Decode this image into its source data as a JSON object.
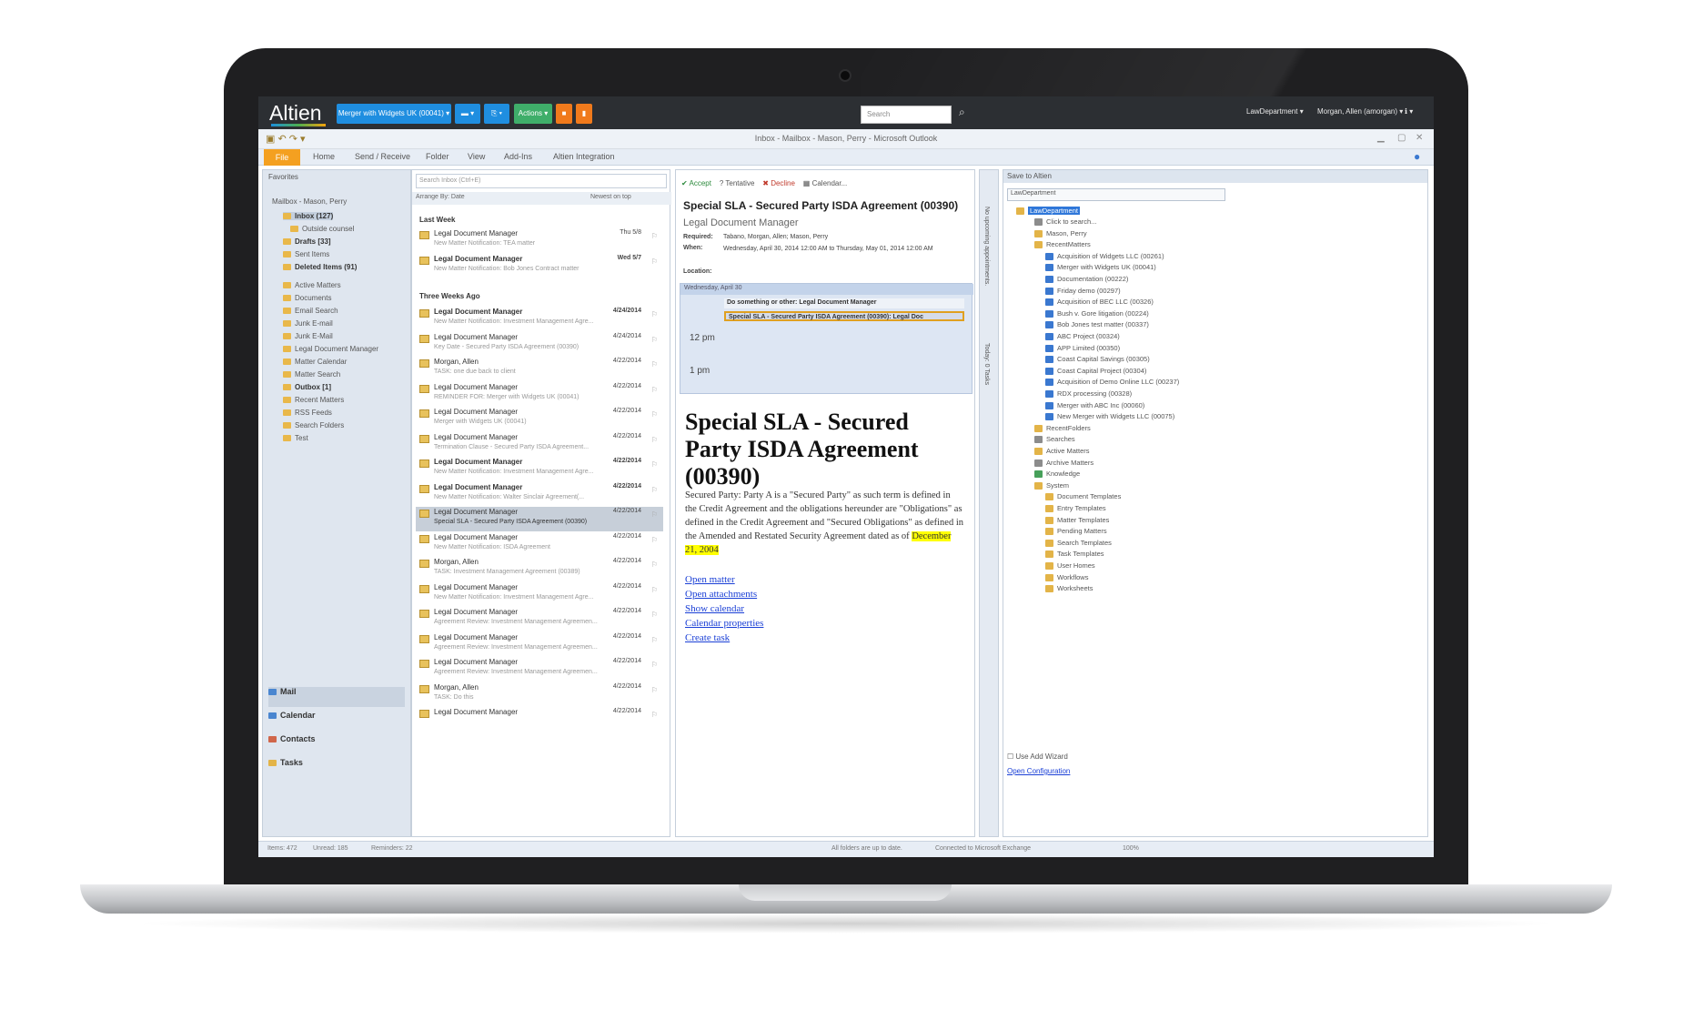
{
  "app": {
    "brand": "Altien",
    "matter_button": "Merger with Widgets UK (00041) ▾",
    "actions_button": "Actions ▾",
    "search_placeholder": "Search",
    "workspace": "LawDepartment ▾",
    "user": "Morgan, Allen (amorgan) ▾",
    "info": "ℹ ▾"
  },
  "outlook": {
    "window_title": "Inbox - Mailbox - Mason, Perry - Microsoft Outlook",
    "tabs": [
      "File",
      "Home",
      "Send / Receive",
      "Folder",
      "View",
      "Add-Ins",
      "Altien Integration"
    ]
  },
  "nav": {
    "favorites": "Favorites",
    "mailbox": "Mailbox - Mason, Perry",
    "folders": [
      {
        "label": "Inbox (127)",
        "bold": true
      },
      {
        "label": "Outside counsel",
        "bold": false
      },
      {
        "label": "Drafts [33]",
        "bold": true
      },
      {
        "label": "Sent Items",
        "bold": false
      },
      {
        "label": "Deleted Items (91)",
        "bold": true
      },
      {
        "label": "Active Matters",
        "bold": false
      },
      {
        "label": "Documents",
        "bold": false
      },
      {
        "label": "Email Search",
        "bold": false
      },
      {
        "label": "Junk E-mail",
        "bold": false
      },
      {
        "label": "Junk E-Mail",
        "bold": false
      },
      {
        "label": "Legal Document Manager",
        "bold": false
      },
      {
        "label": "Matter Calendar",
        "bold": false
      },
      {
        "label": "Matter Search",
        "bold": false
      },
      {
        "label": "Outbox [1]",
        "bold": true
      },
      {
        "label": "Recent Matters",
        "bold": false
      },
      {
        "label": "RSS Feeds",
        "bold": false
      },
      {
        "label": "Search Folders",
        "bold": false
      },
      {
        "label": "Test",
        "bold": false
      }
    ],
    "bottom": [
      "Mail",
      "Calendar",
      "Contacts",
      "Tasks"
    ]
  },
  "list": {
    "search_placeholder": "Search Inbox (Ctrl+E)",
    "arrange": "Arrange By: Date",
    "order": "Newest on top",
    "group_last_week": "Last Week",
    "group_three_weeks": "Three Weeks Ago",
    "mails": [
      {
        "from": "Legal Document Manager",
        "date": "Thu 5/8",
        "subject": "New Matter Notification: TEA matter",
        "bold": false
      },
      {
        "from": "Legal Document Manager",
        "date": "Wed 5/7",
        "subject": "New Matter Notification: Bob Jones Contract matter",
        "bold": true
      },
      {
        "from": "Legal Document Manager",
        "date": "4/24/2014",
        "subject": "New Matter Notification: Investment Management Agre...",
        "bold": true
      },
      {
        "from": "Legal Document Manager",
        "date": "4/24/2014",
        "subject": "Key Date - Secured Party ISDA Agreement (00390)",
        "bold": false
      },
      {
        "from": "Morgan, Allen",
        "date": "4/22/2014",
        "subject": "TASK: one due back to client",
        "bold": false
      },
      {
        "from": "Legal Document Manager",
        "date": "4/22/2014",
        "subject": "REMINDER FOR: Merger with Widgets UK (00041)",
        "bold": false
      },
      {
        "from": "Legal Document Manager",
        "date": "4/22/2014",
        "subject": "Merger with Widgets UK (00041)",
        "bold": false
      },
      {
        "from": "Legal Document Manager",
        "date": "4/22/2014",
        "subject": "Termination Clause - Secured Party ISDA Agreement...",
        "bold": false
      },
      {
        "from": "Legal Document Manager",
        "date": "4/22/2014",
        "subject": "New Matter Notification: Investment Management Agre...",
        "bold": true
      },
      {
        "from": "Legal Document Manager",
        "date": "4/22/2014",
        "subject": "New Matter Notification: Walter Sinclair Agreement(...",
        "bold": true
      },
      {
        "from": "Legal Document Manager",
        "date": "4/22/2014",
        "subject": "Special SLA - Secured Party ISDA Agreement (00390)",
        "bold": false
      },
      {
        "from": "Legal Document Manager",
        "date": "4/22/2014",
        "subject": "New Matter Notification: ISDA Agreement",
        "bold": false
      },
      {
        "from": "Morgan, Allen",
        "date": "4/22/2014",
        "subject": "TASK: Investment Management Agreement (00389)",
        "bold": false
      },
      {
        "from": "Legal Document Manager",
        "date": "4/22/2014",
        "subject": "New Matter Notification: Investment Management Agre...",
        "bold": false
      },
      {
        "from": "Legal Document Manager",
        "date": "4/22/2014",
        "subject": "Agreement Review: Investment Management Agreemen...",
        "bold": false
      },
      {
        "from": "Legal Document Manager",
        "date": "4/22/2014",
        "subject": "Agreement Review: Investment Management Agreemen...",
        "bold": false
      },
      {
        "from": "Legal Document Manager",
        "date": "4/22/2014",
        "subject": "Agreement Review: Investment Management Agreemen...",
        "bold": false
      },
      {
        "from": "Morgan, Allen",
        "date": "4/22/2014",
        "subject": "TASK: Do this",
        "bold": false
      },
      {
        "from": "Legal Document Manager",
        "date": "4/22/2014",
        "subject": "",
        "bold": false
      }
    ]
  },
  "reading": {
    "toolbar": [
      "✔ Accept",
      "? Tentative",
      "✖ Decline",
      "▦ Calendar..."
    ],
    "subject": "Special SLA - Secured Party ISDA Agreement (00390)",
    "sender": "Legal Document Manager",
    "required_label": "Required:",
    "required": "Tabano, Morgan, Allen; Mason, Perry",
    "when_label": "When:",
    "when": "Wednesday, April 30, 2014 12:00 AM to Thursday, May 01, 2014 12:00 AM",
    "location_label": "Location:",
    "cal_day": "Wednesday, April 30",
    "appt1": "Do something or other: Legal Document Manager",
    "appt2": "Special SLA - Secured Party ISDA Agreement (00390): Legal Doc",
    "hour1": "12 pm",
    "hour2": "1 pm",
    "big_title": "Special SLA - Secured Party ISDA Agreement (00390)",
    "body": "Secured Party: Party A is a \"Secured Party\" as such term is defined in the Credit Agreement and the obligations hereunder are \"Obligations\" as defined in the Credit Agreement and \"Secured Obligations\" as defined in the Amended and Restated Security Agreement dated as of",
    "body_date": "December 21, 2004",
    "links": [
      "Open matter",
      "Open attachments",
      "Show calendar",
      "Calendar properties",
      "Create task"
    ]
  },
  "todo": {
    "label1": "No upcoming appointments.",
    "label2": "Today: 0 Tasks"
  },
  "save_pane": {
    "title": "Save to Altien",
    "select": "LawDepartment",
    "root": "LawDepartment",
    "nodes": [
      {
        "label": "Click to search...",
        "indent": 1,
        "color": "gray"
      },
      {
        "label": "Mason, Perry",
        "indent": 1,
        "color": "gold"
      },
      {
        "label": "RecentMatters",
        "indent": 1,
        "color": "gold"
      },
      {
        "label": "Acquisition of Widgets LLC (00261)",
        "indent": 2,
        "color": "blue"
      },
      {
        "label": "Merger with Widgets UK (00041)",
        "indent": 2,
        "color": "blue"
      },
      {
        "label": "Documentation (00222)",
        "indent": 2,
        "color": "blue"
      },
      {
        "label": "Friday demo (00297)",
        "indent": 2,
        "color": "blue"
      },
      {
        "label": "Acquisition of BEC LLC (00326)",
        "indent": 2,
        "color": "blue"
      },
      {
        "label": "Bush v. Gore litigation (00224)",
        "indent": 2,
        "color": "blue"
      },
      {
        "label": "Bob Jones test matter (00337)",
        "indent": 2,
        "color": "blue"
      },
      {
        "label": "ABC Project (00324)",
        "indent": 2,
        "color": "blue"
      },
      {
        "label": "APP Limited (00350)",
        "indent": 2,
        "color": "blue"
      },
      {
        "label": "Coast Capital Savings (00305)",
        "indent": 2,
        "color": "blue"
      },
      {
        "label": "Coast Capital Project (00304)",
        "indent": 2,
        "color": "blue"
      },
      {
        "label": "Acquisition of Demo Online LLC (00237)",
        "indent": 2,
        "color": "blue"
      },
      {
        "label": "RDX processing (00328)",
        "indent": 2,
        "color": "blue"
      },
      {
        "label": "Merger with ABC Inc (00060)",
        "indent": 2,
        "color": "blue"
      },
      {
        "label": "New Merger with Widgets LLC (00075)",
        "indent": 2,
        "color": "blue"
      },
      {
        "label": "RecentFolders",
        "indent": 1,
        "color": "gold"
      },
      {
        "label": "Searches",
        "indent": 1,
        "color": "gray"
      },
      {
        "label": "Active Matters",
        "indent": 1,
        "color": "gold"
      },
      {
        "label": "Archive Matters",
        "indent": 1,
        "color": "gray"
      },
      {
        "label": "Knowledge",
        "indent": 1,
        "color": "green"
      },
      {
        "label": "System",
        "indent": 1,
        "color": "gold"
      },
      {
        "label": "Document Templates",
        "indent": 2,
        "color": "gold"
      },
      {
        "label": "Entry Templates",
        "indent": 2,
        "color": "gold"
      },
      {
        "label": "Matter Templates",
        "indent": 2,
        "color": "gold"
      },
      {
        "label": "Pending Matters",
        "indent": 2,
        "color": "gold"
      },
      {
        "label": "Search Templates",
        "indent": 2,
        "color": "gold"
      },
      {
        "label": "Task Templates",
        "indent": 2,
        "color": "gold"
      },
      {
        "label": "User Homes",
        "indent": 2,
        "color": "gold"
      },
      {
        "label": "Workflows",
        "indent": 2,
        "color": "gold"
      },
      {
        "label": "Worksheets",
        "indent": 2,
        "color": "gold"
      }
    ],
    "wizard": "Use Add Wizard",
    "config": "Open Configuration"
  },
  "status": {
    "items": "Items: 472",
    "unread": "Unread: 185",
    "reminders": "Reminders: 22",
    "uptodate": "All folders are up to date.",
    "connected": "Connected to Microsoft Exchange",
    "zoom": "100%"
  }
}
